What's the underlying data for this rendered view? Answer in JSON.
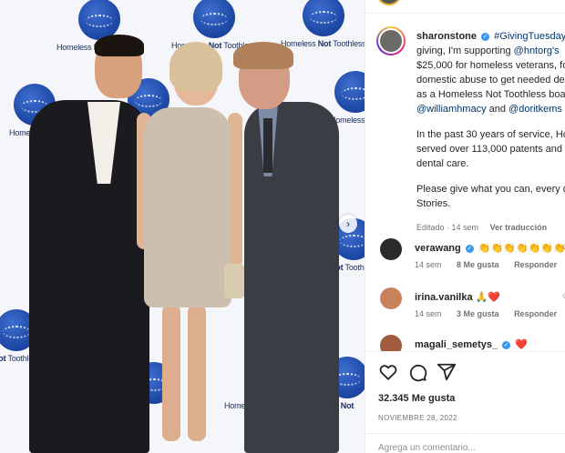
{
  "backdrop": {
    "logo_text_prefix": "Homeless ",
    "logo_text_bold": "Not",
    "logo_text_suffix": " Toothless"
  },
  "post": {
    "carousel_next": "›",
    "caption": {
      "username": "sharonstone",
      "line1_hashtag": "#GivingTuesday",
      "line1_rest": " i",
      "line2_prefix": "giving, I'm supporting ",
      "line2_mention": "@hntorg's",
      "line3": "$25,000 for homeless veterans, fo",
      "line4": "domestic abuse to get needed de",
      "line5": "as a Homeless Not Toothless boa",
      "line6_mention1": "@williamhmacy",
      "line6_and": " and ",
      "line6_mention2": "@doritkems",
      "para2_line1": "In the past 30 years of service, Ho",
      "para2_line2": "served over 113,000 patents and",
      "para2_line3": "dental care.",
      "para3_line1": "Please give what you can, every d",
      "para3_line2": "Stories.",
      "edited": "Editado · 14 sem",
      "translate": "Ver traducción"
    },
    "comments": [
      {
        "username": "verawang",
        "text": "👏👏👏👏👏👏👏",
        "time": "14 sem",
        "likes": "8 Me gusta",
        "reply": "Responder"
      },
      {
        "username": "irina.vanilka",
        "text": "🙏❤️",
        "time": "14 sem",
        "likes": "3 Me gusta",
        "reply": "Responder"
      },
      {
        "username": "magali_semetys_",
        "text": "❤️",
        "time": "",
        "likes": "",
        "reply": ""
      }
    ],
    "likes_count": "32.345 Me gusta",
    "date": "NOVIEMBRE 28, 2022",
    "comment_placeholder": "Agrega un comentario..."
  },
  "colors": {
    "link": "#00376b",
    "verified": "#3897f0",
    "meta_grey": "#737373",
    "logo_blue": "#1f4aa8"
  }
}
